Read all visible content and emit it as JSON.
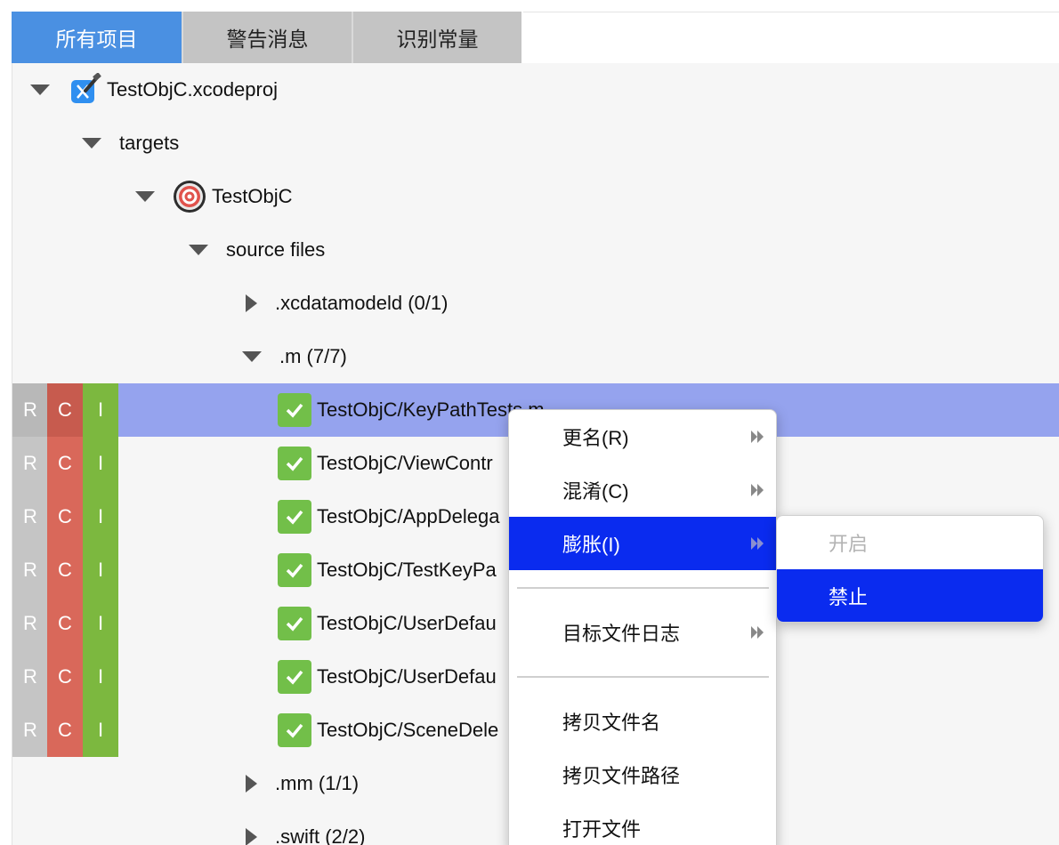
{
  "tabs": [
    {
      "label": "所有项目",
      "active": true
    },
    {
      "label": "警告消息",
      "active": false
    },
    {
      "label": "识别常量",
      "active": false
    }
  ],
  "tree": {
    "project": "TestObjC.xcodeproj",
    "targets": "targets",
    "target": "TestObjC",
    "source_files": "source files",
    "groups": {
      "xcdatamodeld": ".xcdatamodeld (0/1)",
      "m": ".m (7/7)",
      "mm": ".mm (1/1)",
      "swift": ".swift (2/2)"
    },
    "files": [
      {
        "name": "TestObjC/KeyPathTests.m",
        "r": "R",
        "c": "C",
        "i": "I",
        "selected": true
      },
      {
        "name": "TestObjC/ViewContr",
        "r": "R",
        "c": "C",
        "i": "I",
        "selected": false
      },
      {
        "name": "TestObjC/AppDelega",
        "r": "R",
        "c": "C",
        "i": "I",
        "selected": false
      },
      {
        "name": "TestObjC/TestKeyPa",
        "r": "R",
        "c": "C",
        "i": "I",
        "selected": false
      },
      {
        "name": "TestObjC/UserDefau",
        "r": "R",
        "c": "C",
        "i": "I",
        "selected": false
      },
      {
        "name": "TestObjC/UserDefau",
        "r": "R",
        "c": "C",
        "i": "I",
        "selected": false
      },
      {
        "name": "TestObjC/SceneDele",
        "r": "R",
        "c": "C",
        "i": "I",
        "selected": false
      }
    ]
  },
  "context_menu": {
    "items": {
      "rename": "更名(R)",
      "obfuscate": "混淆(C)",
      "inflate": "膨胀(I)",
      "target_log": "目标文件日志",
      "copy_filename": "拷贝文件名",
      "copy_filepath": "拷贝文件路径",
      "open_file": "打开文件"
    },
    "highlighted": "inflate"
  },
  "submenu": {
    "enable": "开启",
    "disable": "禁止",
    "highlighted": "disable"
  },
  "colors": {
    "tab_active": "#4a90e2",
    "selected_row": "#95a3ee",
    "menu_highlight": "#0a2bef",
    "badge_r": "#c5c5c5",
    "badge_c": "#d9685a",
    "badge_i": "#7cb83f",
    "check": "#72bf49"
  }
}
